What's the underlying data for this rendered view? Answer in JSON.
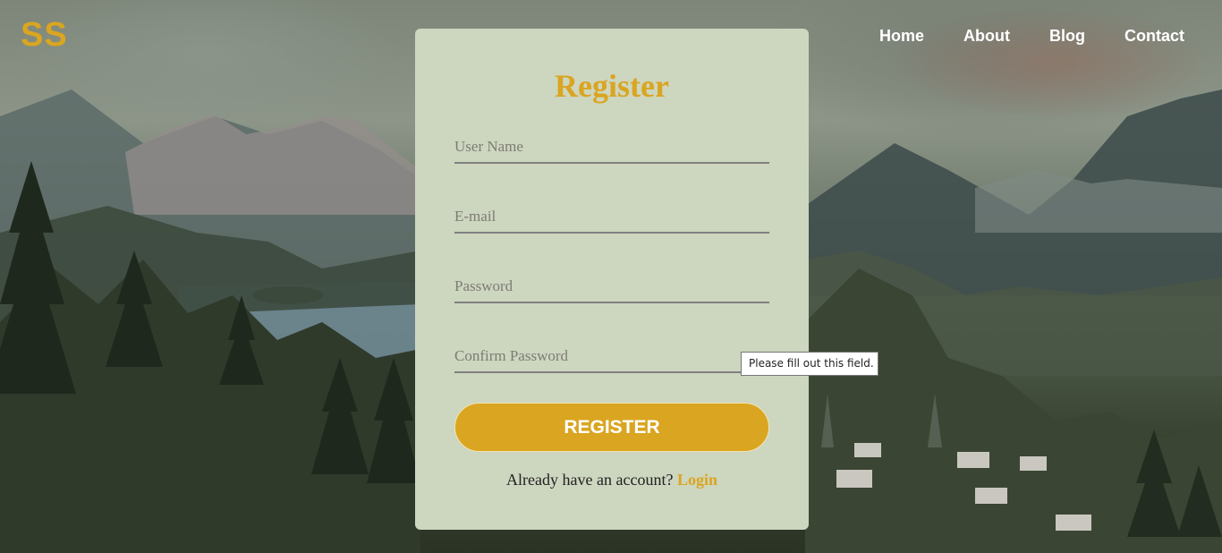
{
  "brand": {
    "logo": "SS"
  },
  "nav": {
    "items": [
      "Home",
      "About",
      "Blog",
      "Contact"
    ]
  },
  "form": {
    "title": "Register",
    "fields": {
      "username_placeholder": "User Name",
      "email_placeholder": "E-mail",
      "password_placeholder": "Password",
      "confirm_placeholder": "Confirm Password"
    },
    "submit_label": "REGISTER",
    "footer_text": "Already have an account? ",
    "login_link": "Login"
  },
  "tooltip": {
    "text": "Please fill out this field."
  },
  "colors": {
    "accent": "#daa520",
    "card_bg": "#cdd6bf",
    "nav_text": "#ffffff"
  }
}
